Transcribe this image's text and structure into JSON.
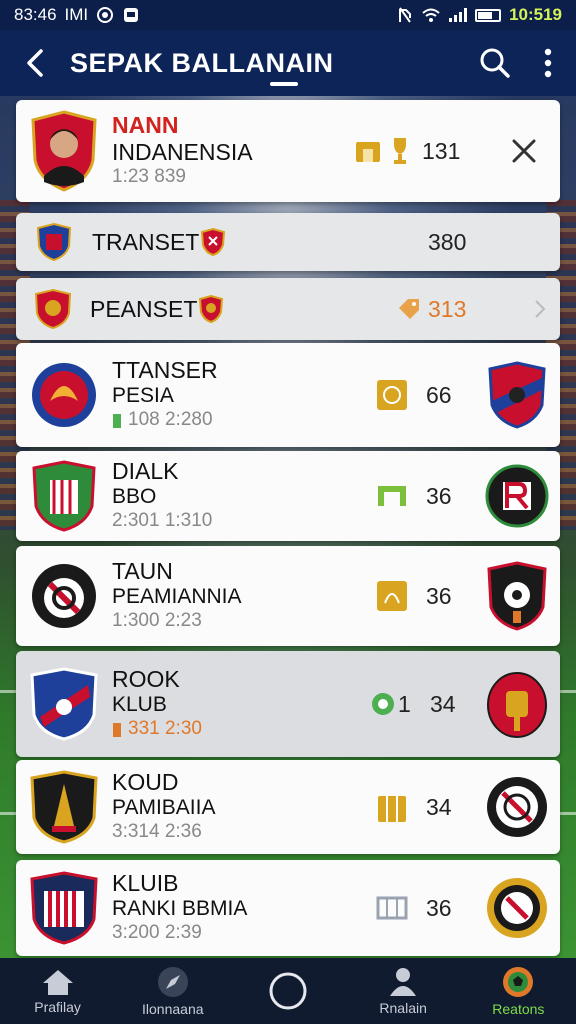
{
  "status_bar": {
    "time_left": "83:46",
    "carrier": "IMI",
    "time_right": "10:519"
  },
  "app_bar": {
    "title": "SEPAK BALLANAIN"
  },
  "header_card": {
    "name_red": "NANN",
    "name": "INDANENSIA",
    "meta": "1:23 839",
    "score": "131"
  },
  "section_rows": [
    {
      "label": "TRANSET",
      "value": "380"
    },
    {
      "label": "PEANSET",
      "value": "313",
      "value_color": "#e0782a"
    }
  ],
  "clubs": [
    {
      "line1": "TTANSER",
      "line2": "PESIA",
      "meta": "108 2:280",
      "score": "66",
      "meta_icon": "green-bar-icon"
    },
    {
      "line1": "DIALK",
      "line2": "BBO",
      "meta": "2:301 1:310",
      "score": "36"
    },
    {
      "line1": "TAUN",
      "line2": "PEAMIANNIA",
      "meta": "1:300 2:23",
      "score": "36"
    },
    {
      "line1": "ROOK",
      "line2": "KLUB",
      "meta": "331 2:30",
      "score": "34",
      "score_prefix": "1",
      "meta_color": "#e0782a"
    },
    {
      "line1": "KOUD",
      "line2": "PAMIBAIIA",
      "meta": "3:314 2:36",
      "score": "34"
    },
    {
      "line1": "KLUIB",
      "line2": "RANKI BBMIA",
      "meta": "3:200 2:39",
      "score": "36"
    }
  ],
  "bottom_nav": [
    {
      "label": "Prafilay",
      "icon": "home-icon"
    },
    {
      "label": "Ilonnaana",
      "icon": "compass-icon"
    },
    {
      "label": "",
      "icon": "circle-icon"
    },
    {
      "label": "Rnalain",
      "icon": "person-icon"
    },
    {
      "label": "Reatons",
      "icon": "soccer-ball-icon",
      "active": true
    }
  ],
  "colors": {
    "app_bar": "#0d2458",
    "status_bar": "#0b1f4a",
    "bottom_nav": "#101b30",
    "accent_orange": "#e0782a",
    "accent_green": "#7fdc4a",
    "gold_icon": "#d9a520"
  }
}
